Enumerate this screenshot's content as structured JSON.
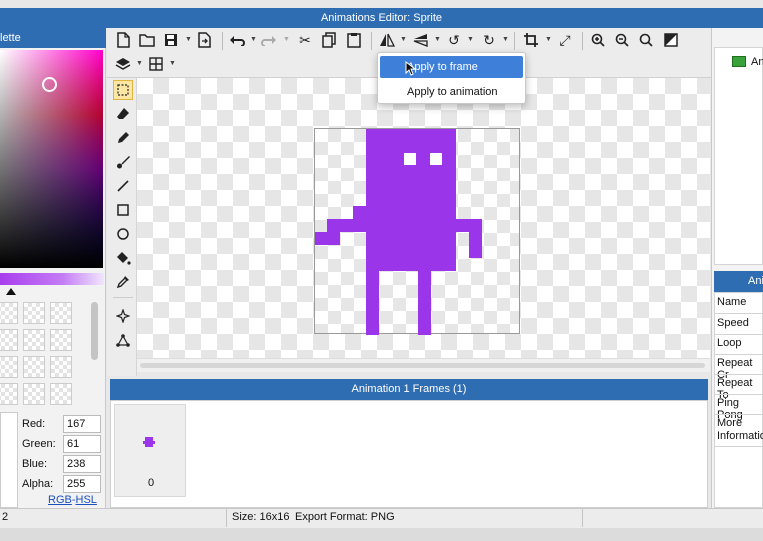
{
  "window": {
    "title": "Animations Editor: Sprite"
  },
  "palette": {
    "title": "lette",
    "red_label": "Red:",
    "red_value": "167",
    "green_label": "Green:",
    "green_value": "61",
    "blue_label": "Blue:",
    "blue_value": "238",
    "alpha_label": "Alpha:",
    "alpha_value": "255",
    "rgb_link": "RGB",
    "separator": "-",
    "hsl_link": "HSL"
  },
  "dropdown": {
    "items": [
      "Apply to frame",
      "Apply to animation"
    ],
    "highlighted_index": 0
  },
  "frames_panel": {
    "title": "Animation 1 Frames (1)",
    "frames": [
      {
        "index_label": "0"
      }
    ]
  },
  "right_panel": {
    "tree_item": "An",
    "props_title": "Ani",
    "props": [
      "Name",
      "Speed",
      "Loop",
      "Repeat Cr",
      "Repeat To",
      "Ping Pong",
      "More",
      "Informatio"
    ]
  },
  "status": {
    "left": "2",
    "size": "Size: 16x16",
    "format": "Export Format: PNG"
  },
  "colors": {
    "sprite": "#9b35ea",
    "accent_blue": "#2f6db3",
    "menu_highlight": "#3d7fd9"
  },
  "icons": [
    "new-file-icon",
    "open-folder-icon",
    "save-icon",
    "export-icon",
    "undo-icon",
    "redo-icon",
    "cut-icon",
    "copy-icon",
    "paste-icon",
    "flip-horizontal-icon",
    "flip-vertical-icon",
    "rotate-left-icon",
    "rotate-right-icon",
    "crop-icon",
    "resize-icon",
    "zoom-in-icon",
    "zoom-out-icon",
    "zoom-fit-icon",
    "invert-icon",
    "layers-icon",
    "grid-icon"
  ]
}
